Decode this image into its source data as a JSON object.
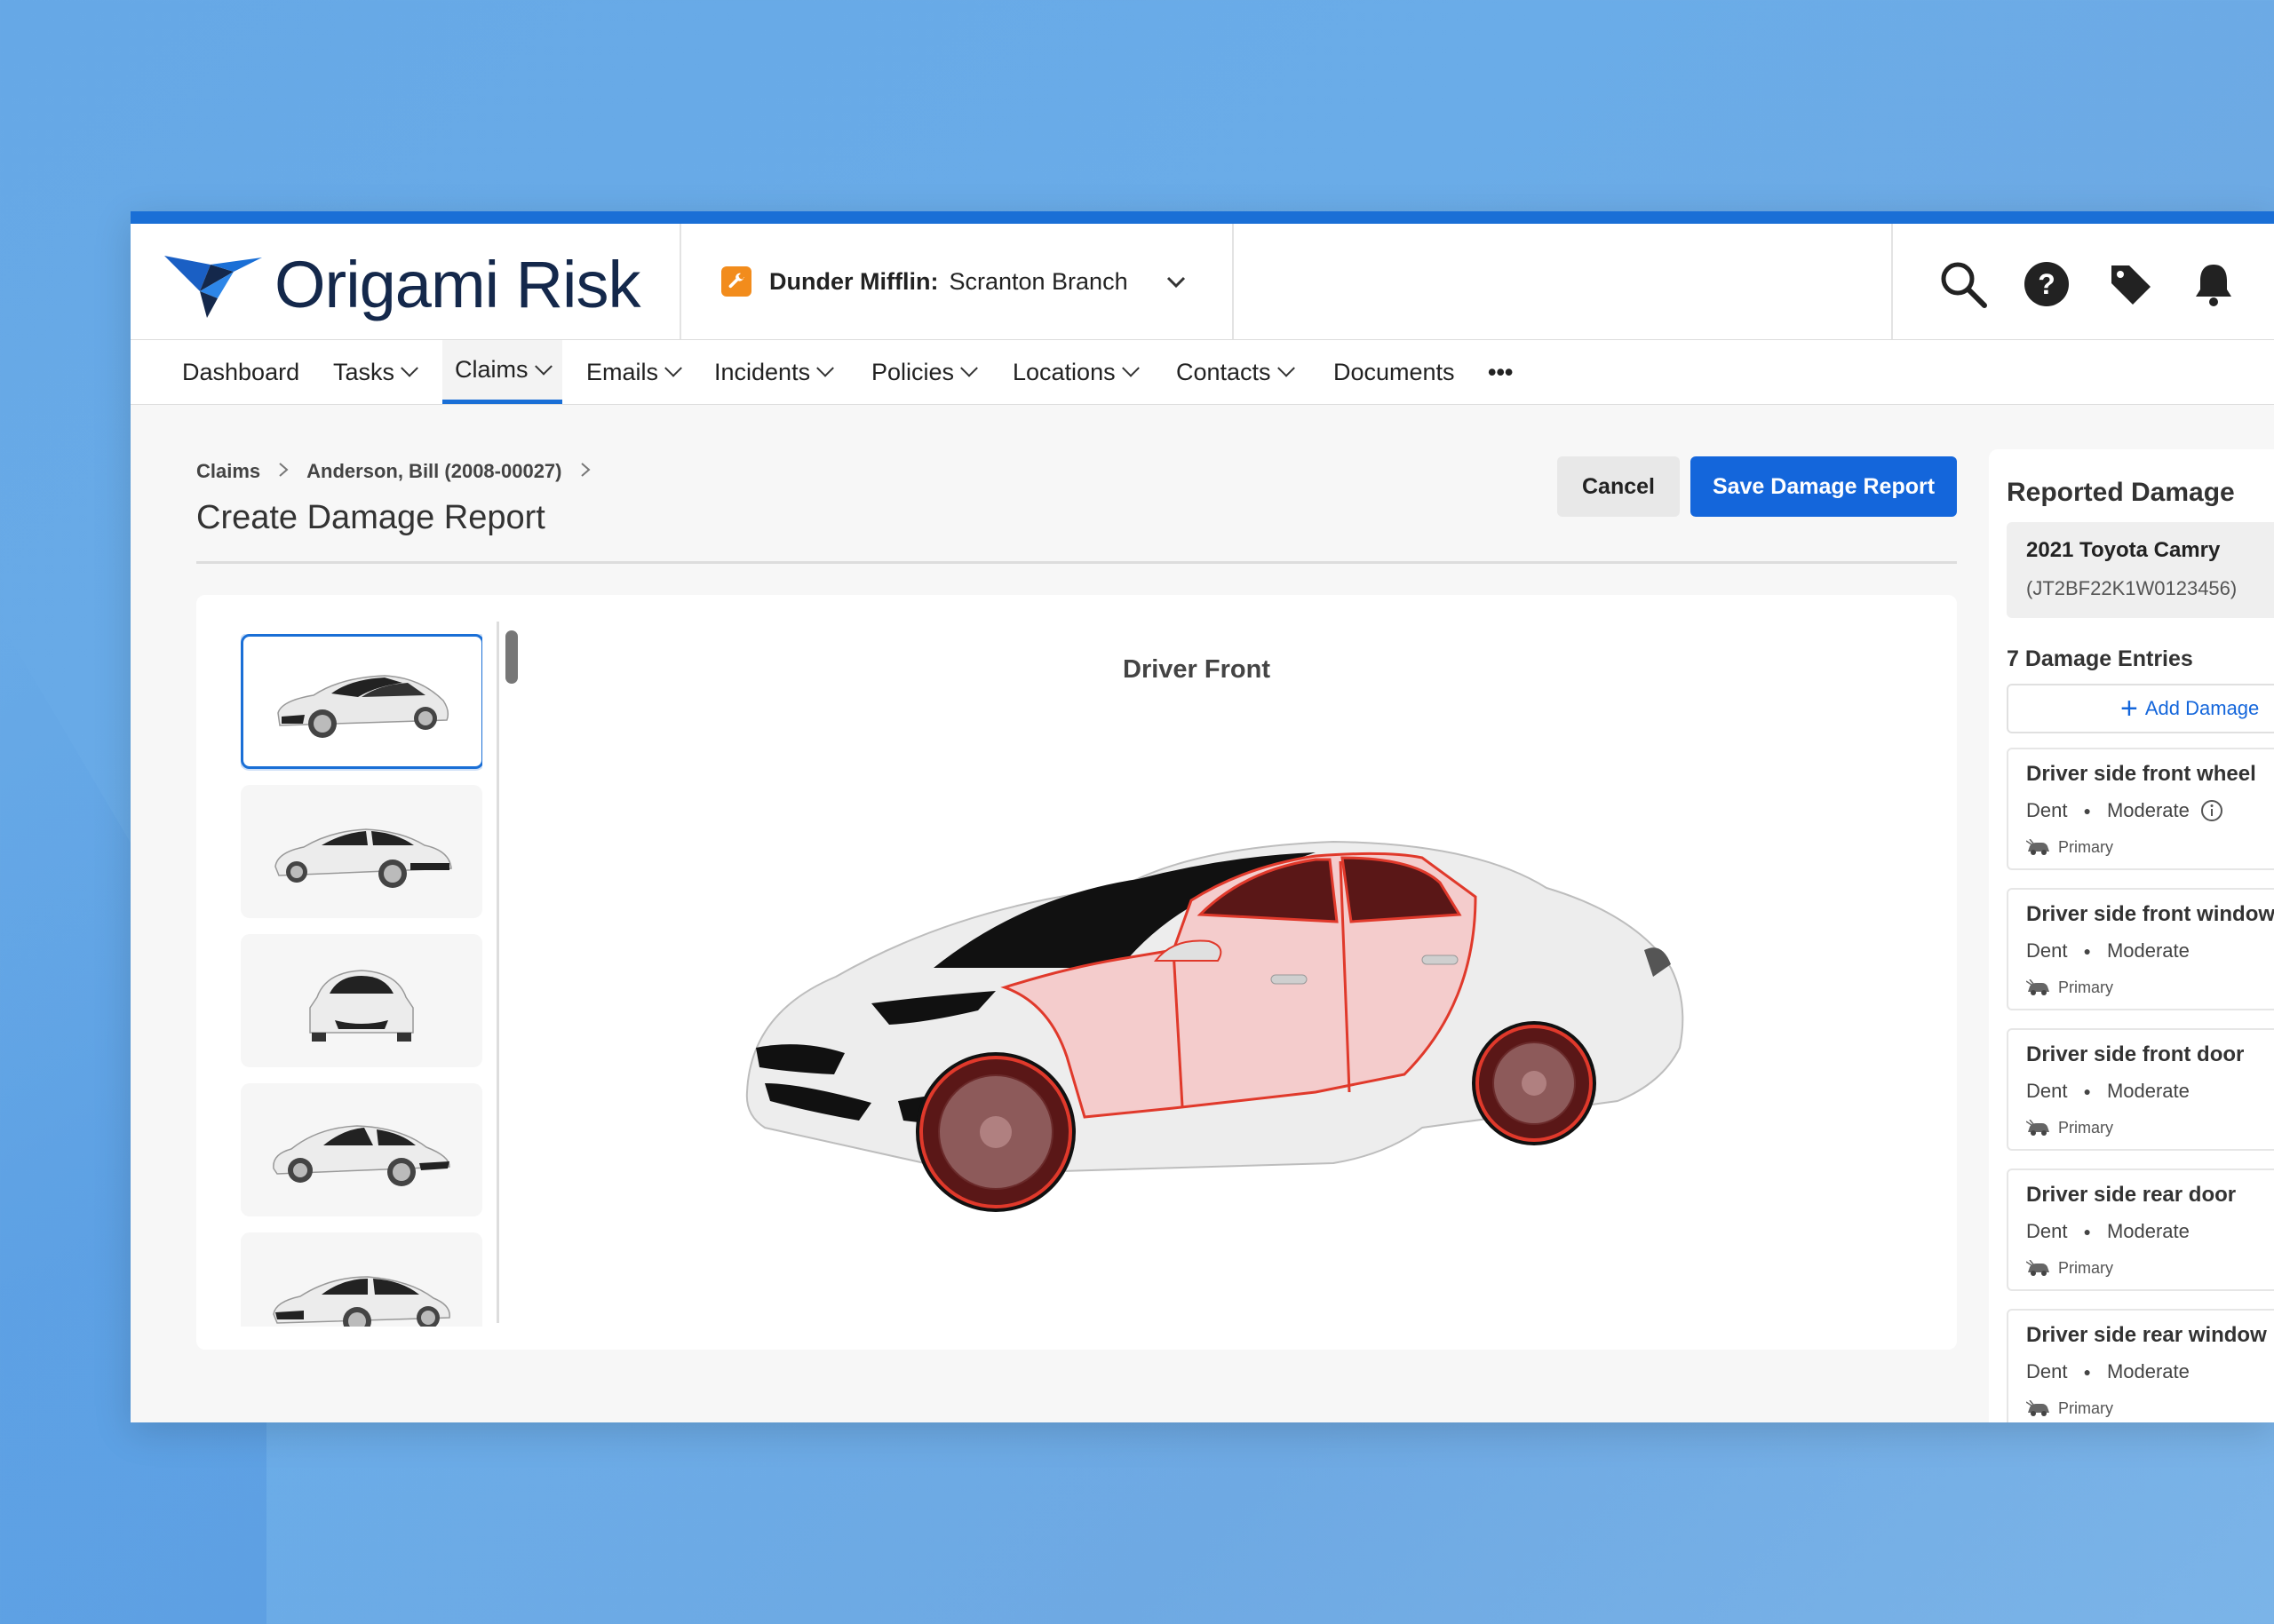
{
  "brand": {
    "name": "Origami Risk"
  },
  "org": {
    "name": "Dunder Mifflin:",
    "branch": "Scranton Branch"
  },
  "topbar_icons": [
    "search-icon",
    "help-icon",
    "tag-icon",
    "bell-icon"
  ],
  "nav": {
    "dashboard": "Dashboard",
    "tasks": "Tasks",
    "claims": "Claims",
    "emails": "Emails",
    "incidents": "Incidents",
    "policies": "Policies",
    "locations": "Locations",
    "contacts": "Contacts",
    "documents": "Documents",
    "more": "•••"
  },
  "breadcrumb": {
    "root": "Claims",
    "claim": "Anderson, Bill (2008-00027)"
  },
  "page": {
    "title": "Create Damage Report"
  },
  "actions": {
    "cancel": "Cancel",
    "save": "Save Damage Report"
  },
  "viewer": {
    "view_title": "Driver Front",
    "thumbnails": [
      "driver-front",
      "driver-rear",
      "front",
      "passenger-front",
      "passenger-rear"
    ],
    "selected_index": 0
  },
  "panel": {
    "title": "Reported Damage",
    "vehicle": {
      "name": "2021 Toyota Camry",
      "vin": "(JT2BF22K1W0123456)"
    },
    "entries_count": "7 Damage Entries",
    "add_label": "Add Damage",
    "entries": [
      {
        "title": "Driver side front wheel",
        "type": "Dent",
        "severity": "Moderate",
        "tag": "Primary"
      },
      {
        "title": "Driver side front window",
        "type": "Dent",
        "severity": "Moderate",
        "tag": "Primary"
      },
      {
        "title": "Driver side front door",
        "type": "Dent",
        "severity": "Moderate",
        "tag": "Primary"
      },
      {
        "title": "Driver side rear door",
        "type": "Dent",
        "severity": "Moderate",
        "tag": "Primary"
      },
      {
        "title": "Driver side rear window",
        "type": "Dent",
        "severity": "Moderate",
        "tag": "Primary"
      }
    ]
  },
  "colors": {
    "accent": "#1466db",
    "damage_outline": "#e0392b",
    "org_icon": "#f28c1c"
  }
}
